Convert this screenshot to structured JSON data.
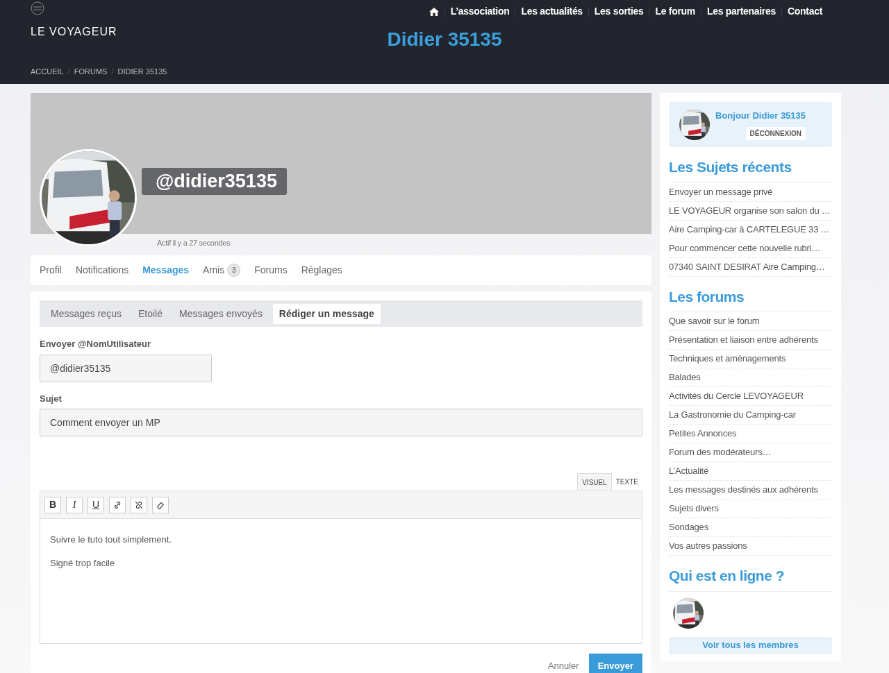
{
  "header": {
    "logo": "LE VOYAGEUR",
    "title": "Didier 35135",
    "nav": [
      {
        "label": "L’association"
      },
      {
        "label": "Les actualités"
      },
      {
        "label": "Les sorties"
      },
      {
        "label": "Le forum"
      },
      {
        "label": "Les partenaires"
      },
      {
        "label": "Contact"
      }
    ],
    "breadcrumb": [
      "ACCUEIL",
      "FORUMS",
      "DIDIER 35135"
    ],
    "breadcrumb_separator": "/"
  },
  "profile": {
    "handle": "@didier35135",
    "activity": "Actif il y a 27 secondes"
  },
  "tabs": [
    {
      "label": "Profil",
      "selected": false
    },
    {
      "label": "Notifications",
      "selected": false
    },
    {
      "label": "Messages",
      "selected": true
    },
    {
      "label": "Amis",
      "selected": false,
      "count": "3"
    },
    {
      "label": "Forums",
      "selected": false
    },
    {
      "label": "Réglages",
      "selected": false
    }
  ],
  "subtabs": [
    {
      "label": "Messages reçus",
      "selected": false
    },
    {
      "label": "Etoilé",
      "selected": false
    },
    {
      "label": "Messages envoyés",
      "selected": false
    },
    {
      "label": "Rédiger un message",
      "selected": true
    }
  ],
  "form": {
    "to_label": "Envoyer @NomUtilisateur",
    "to_value": "@didier35135",
    "subject_label": "Sujet",
    "subject_value": "Comment envoyer un MP",
    "editor_tabs": [
      {
        "label": "VISUEL",
        "selected": true
      },
      {
        "label": "TEXTE",
        "selected": false
      }
    ],
    "toolbar": [
      {
        "kind": "bold",
        "label": "B"
      },
      {
        "kind": "italic",
        "label": "I"
      },
      {
        "kind": "underline",
        "label": "U"
      },
      {
        "kind": "link"
      },
      {
        "kind": "unlink"
      },
      {
        "kind": "eraser"
      }
    ],
    "body": [
      "Suivre le tuto tout simplement.",
      "Signé trop facile"
    ],
    "cancel": "Annuler",
    "send": "Envoyer"
  },
  "sidebar": {
    "greeting": "Bonjour Didier 35135",
    "logout": "DÉCONNEXION",
    "recent_title": "Les Sujets récents",
    "recent": [
      "Envoyer un message privé",
      "LE VOYAGEUR organise son salon du …",
      "Aire Camping-car à CARTELEGUE 33 …",
      "Pour commencer cette nouvelle rubri…",
      "07340 SAINT DESIRAT Aire Camping…"
    ],
    "forums_title": "Les forums",
    "forums": [
      "Que savoir sur le forum",
      "Présentation et liaison entre adhérents",
      "Techniques et aménagements",
      "Balades",
      "Activités du Cercle LEVOYAGEUR",
      "La Gastronomie du Camping-car",
      "Petites Annonces",
      "Forum des modérateurs…",
      "L’Actualité",
      "Les messages destinés aux adhérents",
      "Sujets divers",
      "Sondages",
      "Vos autres passions"
    ],
    "online_title": "Qui est en ligne ?",
    "all_members": "Voir tous les membres"
  }
}
